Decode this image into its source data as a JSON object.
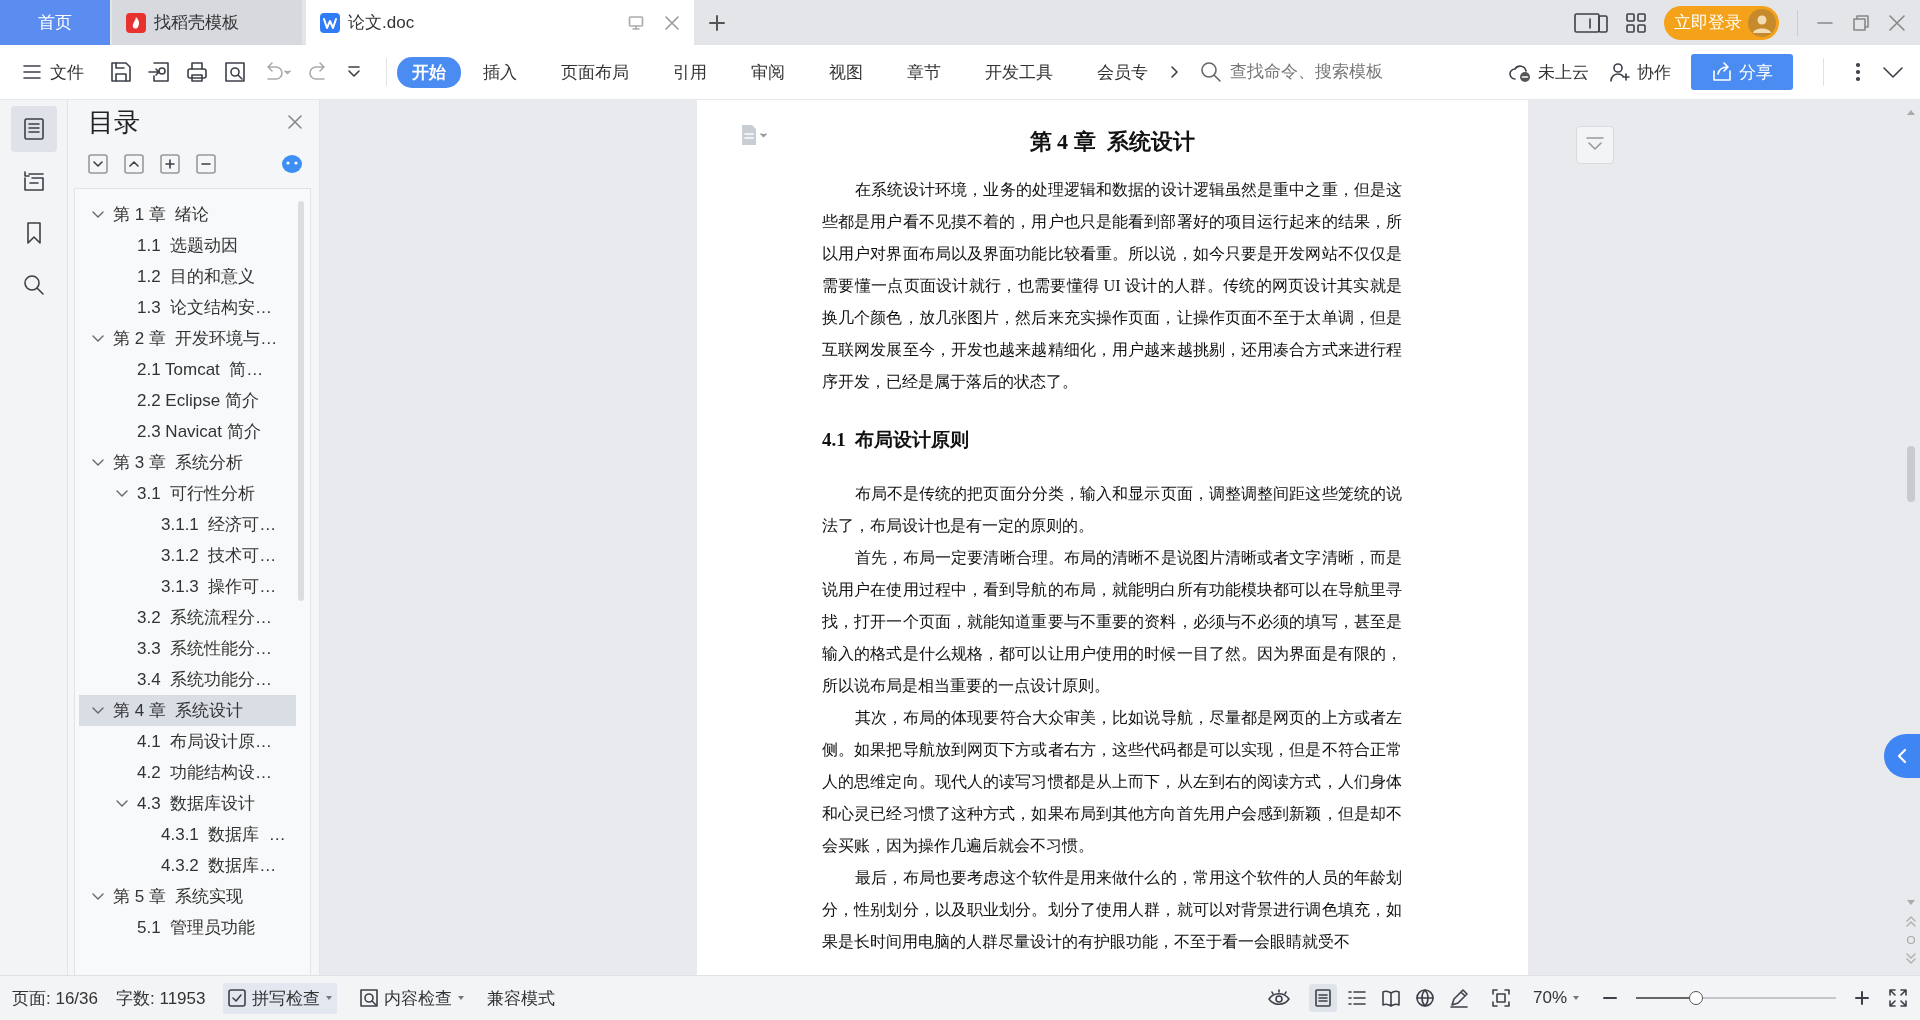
{
  "tabs": [
    {
      "label": "首页",
      "kind": "home",
      "selected": false
    },
    {
      "label": "找稻壳模板",
      "kind": "template",
      "selected": false
    },
    {
      "label": "论文.doc",
      "kind": "doc",
      "selected": true
    }
  ],
  "account": {
    "login": "立即登录"
  },
  "toolbar": {
    "file_menu": "文件",
    "ribbon_tabs": [
      {
        "label": "开始",
        "selected": true
      },
      {
        "label": "插入",
        "selected": false
      },
      {
        "label": "页面布局",
        "selected": false
      },
      {
        "label": "引用",
        "selected": false
      },
      {
        "label": "审阅",
        "selected": false
      },
      {
        "label": "视图",
        "selected": false
      },
      {
        "label": "章节",
        "selected": false
      },
      {
        "label": "开发工具",
        "selected": false
      },
      {
        "label": "会员专",
        "selected": false
      }
    ],
    "search": {
      "placeholder": "查找命令、搜索模板"
    },
    "actions": [
      {
        "label": "未上云",
        "kind": "cloud"
      },
      {
        "label": "协作",
        "kind": "collab"
      },
      {
        "label": "分享",
        "kind": "share"
      }
    ]
  },
  "outline": {
    "title": "目录",
    "items": [
      {
        "label": "第 1 章  绪论",
        "expanded": true,
        "selected": false,
        "children": [
          {
            "label": "1.1  选题动因",
            "selected": false
          },
          {
            "label": "1.2  目的和意义",
            "selected": false
          },
          {
            "label": "1.3  论文结构安…",
            "selected": false
          }
        ]
      },
      {
        "label": "第 2 章  开发环境与…",
        "expanded": true,
        "selected": false,
        "children": [
          {
            "label": "2.1 Tomcat  简…",
            "selected": false
          },
          {
            "label": "2.2 Eclipse 简介",
            "selected": false
          },
          {
            "label": "2.3 Navicat 简介",
            "selected": false
          }
        ]
      },
      {
        "label": "第 3 章  系统分析",
        "expanded": true,
        "selected": false,
        "children": [
          {
            "label": "3.1  可行性分析",
            "expanded": true,
            "selected": false,
            "children": [
              {
                "label": "3.1.1  经济可…",
                "selected": false
              },
              {
                "label": "3.1.2  技术可…",
                "selected": false
              },
              {
                "label": "3.1.3  操作可…",
                "selected": false
              }
            ]
          },
          {
            "label": "3.2  系统流程分…",
            "selected": false
          },
          {
            "label": "3.3  系统性能分…",
            "selected": false
          },
          {
            "label": "3.4  系统功能分…",
            "selected": false
          }
        ]
      },
      {
        "label": "第 4 章  系统设计",
        "expanded": true,
        "selected": true,
        "children": [
          {
            "label": "4.1  布局设计原…",
            "selected": false
          },
          {
            "label": "4.2  功能结构设…",
            "selected": false
          },
          {
            "label": "4.3  数据库设计",
            "expanded": true,
            "selected": false,
            "children": [
              {
                "label": "4.3.1  数据库  …",
                "selected": false
              },
              {
                "label": "4.3.2  数据库…",
                "selected": false
              }
            ]
          }
        ]
      },
      {
        "label": "第 5 章  系统实现",
        "expanded": true,
        "selected": false,
        "children": [
          {
            "label": "5.1  管理员功能",
            "selected": false
          }
        ]
      }
    ]
  },
  "document": {
    "blocks": [
      {
        "kind": "chapter",
        "text": "第 4 章  系统设计"
      },
      {
        "kind": "paragraph",
        "text": "在系统设计环境，业务的处理逻辑和数据的设计逻辑虽然是重中之重，但是这些都是用户看不见摸不着的，用户也只是能看到部署好的项目运行起来的结果，所以用户对界面布局以及界面功能比较看重。所以说，如今只要是开发网站不仅仅是需要懂一点页面设计就行，也需要懂得 UI 设计的人群。传统的网页设计其实就是换几个颜色，放几张图片，然后来充实操作页面，让操作页面不至于太单调，但是互联网发展至今，开发也越来越精细化，用户越来越挑剔，还用凑合方式来进行程序开发，已经是属于落后的状态了。"
      },
      {
        "kind": "section",
        "text": "4.1  布局设计原则"
      },
      {
        "kind": "paragraph",
        "text": "布局不是传统的把页面分分类，输入和显示页面，调整调整间距这些笼统的说法了，布局设计也是有一定的原则的。"
      },
      {
        "kind": "paragraph",
        "text": "首先，布局一定要清晰合理。布局的清晰不是说图片清晰或者文字清晰，而是说用户在使用过程中，看到导航的布局，就能明白所有功能模块都可以在导航里寻找，打开一个页面，就能知道重要与不重要的资料，必须与不必须的填写，甚至是输入的格式是什么规格，都可以让用户使用的时候一目了然。因为界面是有限的，所以说布局是相当重要的一点设计原则。"
      },
      {
        "kind": "paragraph",
        "text": "其次，布局的体现要符合大众审美，比如说导航，尽量都是网页的上方或者左侧。如果把导航放到网页下方或者右方，这些代码都是可以实现，但是不符合正常人的思维定向。现代人的读写习惯都是从上而下，从左到右的阅读方式，人们身体和心灵已经习惯了这种方式，如果布局到其他方向首先用户会感到新颖，但是却不会买账，因为操作几遍后就会不习惯。"
      },
      {
        "kind": "paragraph",
        "text": "最后，布局也要考虑这个软件是用来做什么的，常用这个软件的人员的年龄划分，性别划分，以及职业划分。划分了使用人群，就可以对背景进行调色填充，如果是长时间用电脑的人群尽量设计的有护眼功能，不至于看一会眼睛就受不"
      }
    ]
  },
  "status_bar": {
    "page": "页面: 16/36",
    "words": "字数: 11953",
    "spell_check": "拼写检查",
    "content_check": "内容检查",
    "mode": "兼容模式",
    "views": [
      {
        "kind": "page",
        "selected": true
      },
      {
        "kind": "outline",
        "selected": false
      },
      {
        "kind": "read",
        "selected": false
      },
      {
        "kind": "web",
        "selected": false
      },
      {
        "kind": "write",
        "selected": false
      }
    ],
    "zoom": "70%",
    "zoom_slider": {
      "level": 0.3
    }
  }
}
